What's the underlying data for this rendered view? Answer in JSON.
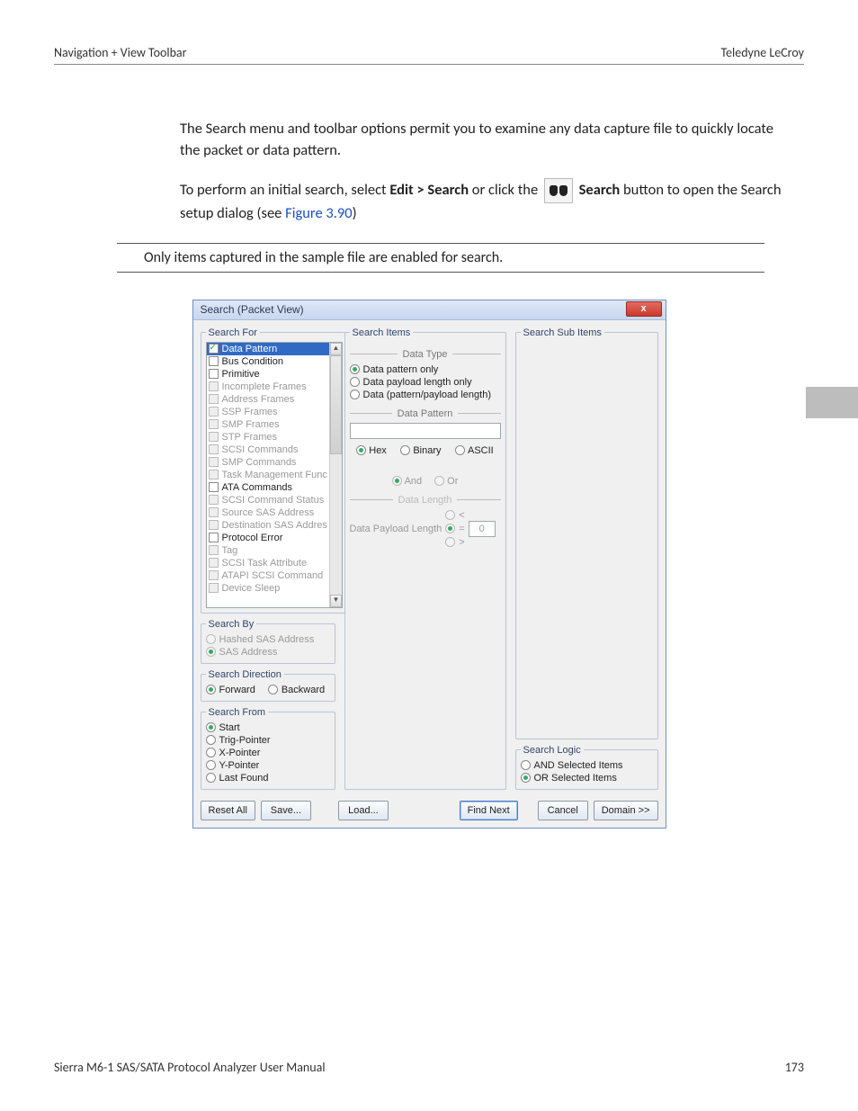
{
  "header": {
    "left": "Navigation + View Toolbar",
    "right": "Teledyne LeCroy"
  },
  "body": {
    "p1": "The Search menu and toolbar options permit you to examine any data capture file to quickly locate the packet or data pattern.",
    "p2a": "To perform an initial search, select ",
    "p2b": "Edit > Search",
    "p2c": " or click the ",
    "p2d": "Search",
    "p2e": " button to open the Search setup dialog (see ",
    "figref": "Figure 3.90",
    "p2f": ")",
    "note": "Only items captured in the sample file are enabled for search."
  },
  "dialog": {
    "title": "Search (Packet View)",
    "close": "x",
    "searchFor": {
      "legend": "Search For",
      "items": [
        {
          "label": "Data Pattern",
          "enabled": true,
          "checked": true,
          "selected": true
        },
        {
          "label": "Bus Condition",
          "enabled": true,
          "checked": false
        },
        {
          "label": "Primitive",
          "enabled": true,
          "checked": false
        },
        {
          "label": "Incomplete Frames",
          "enabled": false
        },
        {
          "label": "Address Frames",
          "enabled": false
        },
        {
          "label": "SSP Frames",
          "enabled": false
        },
        {
          "label": "SMP Frames",
          "enabled": false
        },
        {
          "label": "STP Frames",
          "enabled": false
        },
        {
          "label": "SCSI Commands",
          "enabled": false
        },
        {
          "label": "SMP Commands",
          "enabled": false
        },
        {
          "label": "Task Management Func",
          "enabled": false
        },
        {
          "label": "ATA Commands",
          "enabled": true,
          "checked": false
        },
        {
          "label": "SCSI Command Status",
          "enabled": false
        },
        {
          "label": "Source SAS Address",
          "enabled": false
        },
        {
          "label": "Destination SAS Addres",
          "enabled": false
        },
        {
          "label": "Protocol Error",
          "enabled": true,
          "checked": false
        },
        {
          "label": "Tag",
          "enabled": false
        },
        {
          "label": "SCSI Task Attribute",
          "enabled": false
        },
        {
          "label": "ATAPI SCSI Command",
          "enabled": false
        },
        {
          "label": "Device Sleep",
          "enabled": false
        }
      ]
    },
    "searchBy": {
      "legend": "Search By",
      "options": [
        {
          "label": "Hashed SAS Address",
          "selected": false
        },
        {
          "label": "SAS Address",
          "selected": true
        }
      ]
    },
    "searchDirection": {
      "legend": "Search Direction",
      "options": [
        {
          "label": "Forward",
          "selected": true
        },
        {
          "label": "Backward",
          "selected": false
        }
      ]
    },
    "searchFrom": {
      "legend": "Search From",
      "options": [
        {
          "label": "Start",
          "selected": true
        },
        {
          "label": "Trig-Pointer",
          "selected": false
        },
        {
          "label": "X-Pointer",
          "selected": false
        },
        {
          "label": "Y-Pointer",
          "selected": false
        },
        {
          "label": "Last Found",
          "selected": false
        }
      ]
    },
    "searchItems": {
      "legend": "Search Items",
      "dataType": {
        "title": "Data Type",
        "options": [
          {
            "label": "Data pattern only",
            "selected": true
          },
          {
            "label": "Data payload length only",
            "selected": false
          },
          {
            "label": "Data (pattern/payload length)",
            "selected": false
          }
        ]
      },
      "dataPattern": {
        "title": "Data Pattern",
        "format": [
          {
            "label": "Hex",
            "selected": true
          },
          {
            "label": "Binary",
            "selected": false
          },
          {
            "label": "ASCII",
            "selected": false
          }
        ],
        "logic": [
          {
            "label": "And",
            "selected": true
          },
          {
            "label": "Or",
            "selected": false
          }
        ]
      },
      "dataLength": {
        "title": "Data Length",
        "label": "Data Payload Length",
        "ops": [
          "<",
          "=",
          ">"
        ],
        "selectedOp": "=",
        "value": "0"
      }
    },
    "searchSubItems": {
      "legend": "Search Sub Items"
    },
    "searchLogic": {
      "legend": "Search Logic",
      "options": [
        {
          "label": "AND Selected Items",
          "selected": false
        },
        {
          "label": "OR Selected Items",
          "selected": true
        }
      ]
    },
    "buttons": {
      "resetAll": "Reset All",
      "save": "Save...",
      "load": "Load...",
      "findNext": "Find Next",
      "cancel": "Cancel",
      "domain": "Domain >>"
    }
  },
  "footer": {
    "left": "Sierra M6-1 SAS/SATA Protocol Analyzer User Manual",
    "right": "173"
  }
}
